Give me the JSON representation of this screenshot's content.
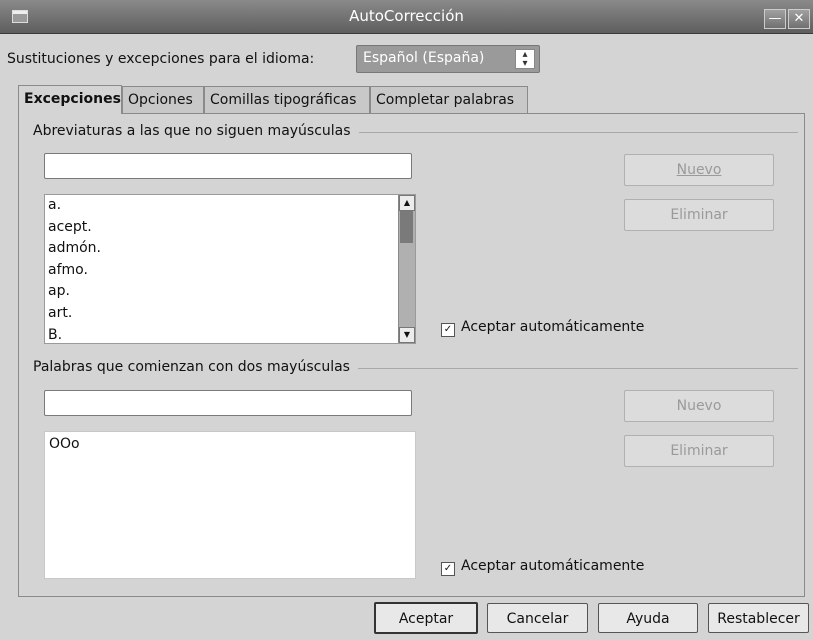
{
  "window": {
    "title": "AutoCorrección",
    "minimize_glyph": "—",
    "close_glyph": "✕"
  },
  "language": {
    "label": "Sustituciones y excepciones para el idioma:",
    "selected": "Español (España)"
  },
  "tabs": [
    {
      "label": "Excepciones",
      "active": true
    },
    {
      "label": "Opciones",
      "active": false
    },
    {
      "label": "Comillas tipográficas",
      "active": false
    },
    {
      "label": "Completar palabras",
      "active": false
    }
  ],
  "abbreviations": {
    "title": "Abreviaturas a las que no siguen mayúsculas",
    "input_value": "",
    "items": [
      "a.",
      "acept.",
      "admón.",
      "afmo.",
      "ap.",
      "art.",
      "B."
    ],
    "new_button": "Nuevo",
    "delete_button": "Eliminar",
    "auto_accept_label": "Aceptar automáticamente",
    "auto_accept_checked": true
  },
  "two_capitals": {
    "title": "Palabras que comienzan con dos mayúsculas",
    "input_value": "",
    "items": [
      "OOo"
    ],
    "new_button": "Nuevo",
    "delete_button": "Eliminar",
    "auto_accept_label": "Aceptar automáticamente",
    "auto_accept_checked": true
  },
  "footer": {
    "accept": "Aceptar",
    "cancel": "Cancelar",
    "help": "Ayuda",
    "reset": "Restablecer"
  },
  "icons": {
    "window_icon": "window-icon",
    "minimize": "minimize-icon",
    "close": "close-icon",
    "spin": "spinner-icon",
    "scroll_up": "arrow-up-icon",
    "scroll_down": "arrow-down-icon",
    "check": "checkmark-icon"
  }
}
